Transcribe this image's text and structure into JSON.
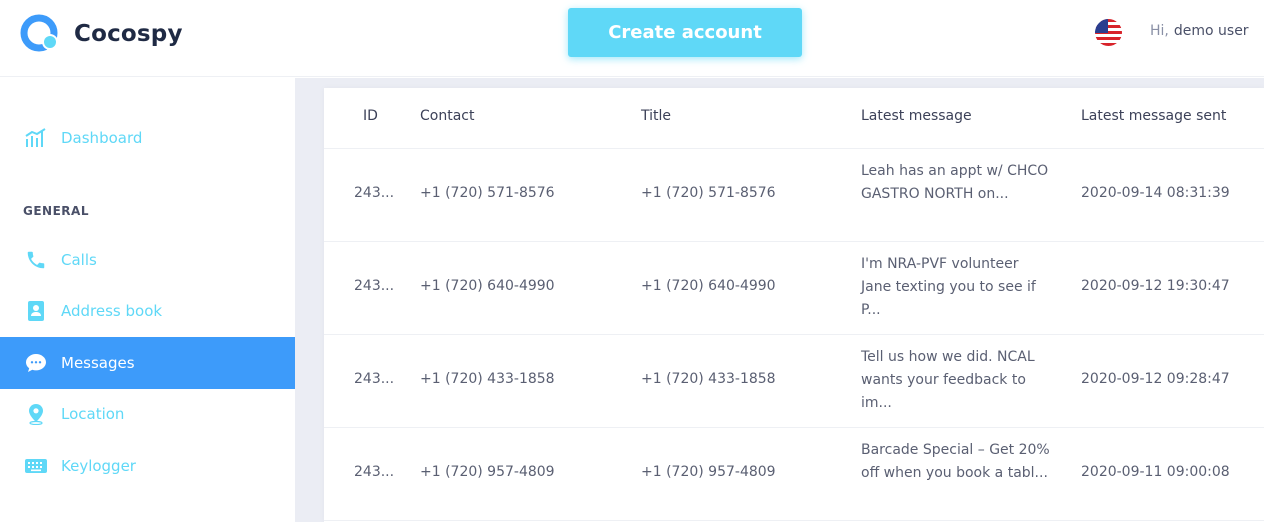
{
  "brand": {
    "name": "Cocospy"
  },
  "header": {
    "cta_label": "Create account",
    "greeting_hi": "Hi,",
    "user_name": "demo user"
  },
  "sidebar": {
    "items": [
      {
        "label": "Dashboard",
        "icon": "bar-chart-icon"
      },
      {
        "label": "Calls",
        "icon": "phone-icon"
      },
      {
        "label": "Address book",
        "icon": "address-book-icon"
      },
      {
        "label": "Messages",
        "icon": "sms-bubble-icon",
        "active": true
      },
      {
        "label": "Location",
        "icon": "location-pin-icon"
      },
      {
        "label": "Keylogger",
        "icon": "keyboard-icon"
      }
    ],
    "section_general": "GENERAL"
  },
  "table": {
    "columns": [
      "ID",
      "Contact",
      "Title",
      "Latest message",
      "Latest message sent"
    ],
    "rows": [
      {
        "id": "243...",
        "contact": "+1 (720) 571-8576",
        "title": "+1 (720) 571-8576",
        "message": "Leah has an appt w/ CHCO GASTRO NORTH on...",
        "sent": "2020-09-14 08:31:39"
      },
      {
        "id": "243...",
        "contact": "+1 (720) 640-4990",
        "title": "+1 (720) 640-4990",
        "message": "I'm NRA-PVF volunteer Jane texting you to see if P...",
        "sent": "2020-09-12 19:30:47"
      },
      {
        "id": "243...",
        "contact": "+1 (720) 433-1858",
        "title": "+1 (720) 433-1858",
        "message": "Tell us how we did. NCAL wants your feedback to im...",
        "sent": "2020-09-12 09:28:47"
      },
      {
        "id": "243...",
        "contact": "+1 (720) 957-4809",
        "title": "+1 (720) 957-4809",
        "message": "Barcade Special – Get 20% off when you book a tabl...",
        "sent": "2020-09-11 09:00:08"
      }
    ]
  },
  "colors": {
    "accent": "#5fd8f7",
    "active_nav": "#3d9bfa",
    "brand_dark": "#1f2a44",
    "main_bg": "#ebedf4"
  }
}
